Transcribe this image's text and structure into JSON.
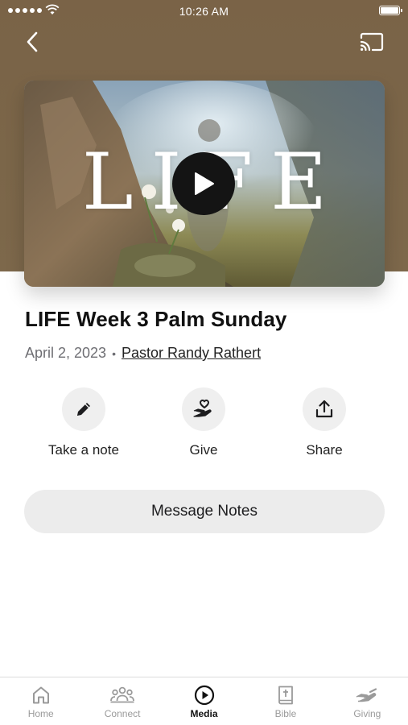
{
  "status_bar": {
    "time": "10:26 AM"
  },
  "header": {
    "back_icon": "chevron-left-icon",
    "cast_icon": "cast-icon"
  },
  "video": {
    "overlay_title": "LIFE",
    "play_icon": "play-icon"
  },
  "sermon": {
    "title": "LIFE Week 3 Palm Sunday",
    "date": "April 2, 2023",
    "separator": "•",
    "speaker": "Pastor Randy Rathert"
  },
  "actions": [
    {
      "label": "Take a note",
      "icon": "pencil-icon"
    },
    {
      "label": "Give",
      "icon": "heart-hand-icon"
    },
    {
      "label": "Share",
      "icon": "share-icon"
    }
  ],
  "message_notes_label": "Message Notes",
  "tabs": [
    {
      "label": "Home",
      "icon": "home-icon",
      "active": false
    },
    {
      "label": "Connect",
      "icon": "people-icon",
      "active": false
    },
    {
      "label": "Media",
      "icon": "play-circle-icon",
      "active": true
    },
    {
      "label": "Bible",
      "icon": "bible-icon",
      "active": false
    },
    {
      "label": "Giving",
      "icon": "giving-hand-icon",
      "active": false
    }
  ],
  "colors": {
    "header_bg": "#7b6649",
    "button_bg": "#ececec",
    "active_tab": "#111111",
    "inactive_tab": "#9a9a9a"
  }
}
